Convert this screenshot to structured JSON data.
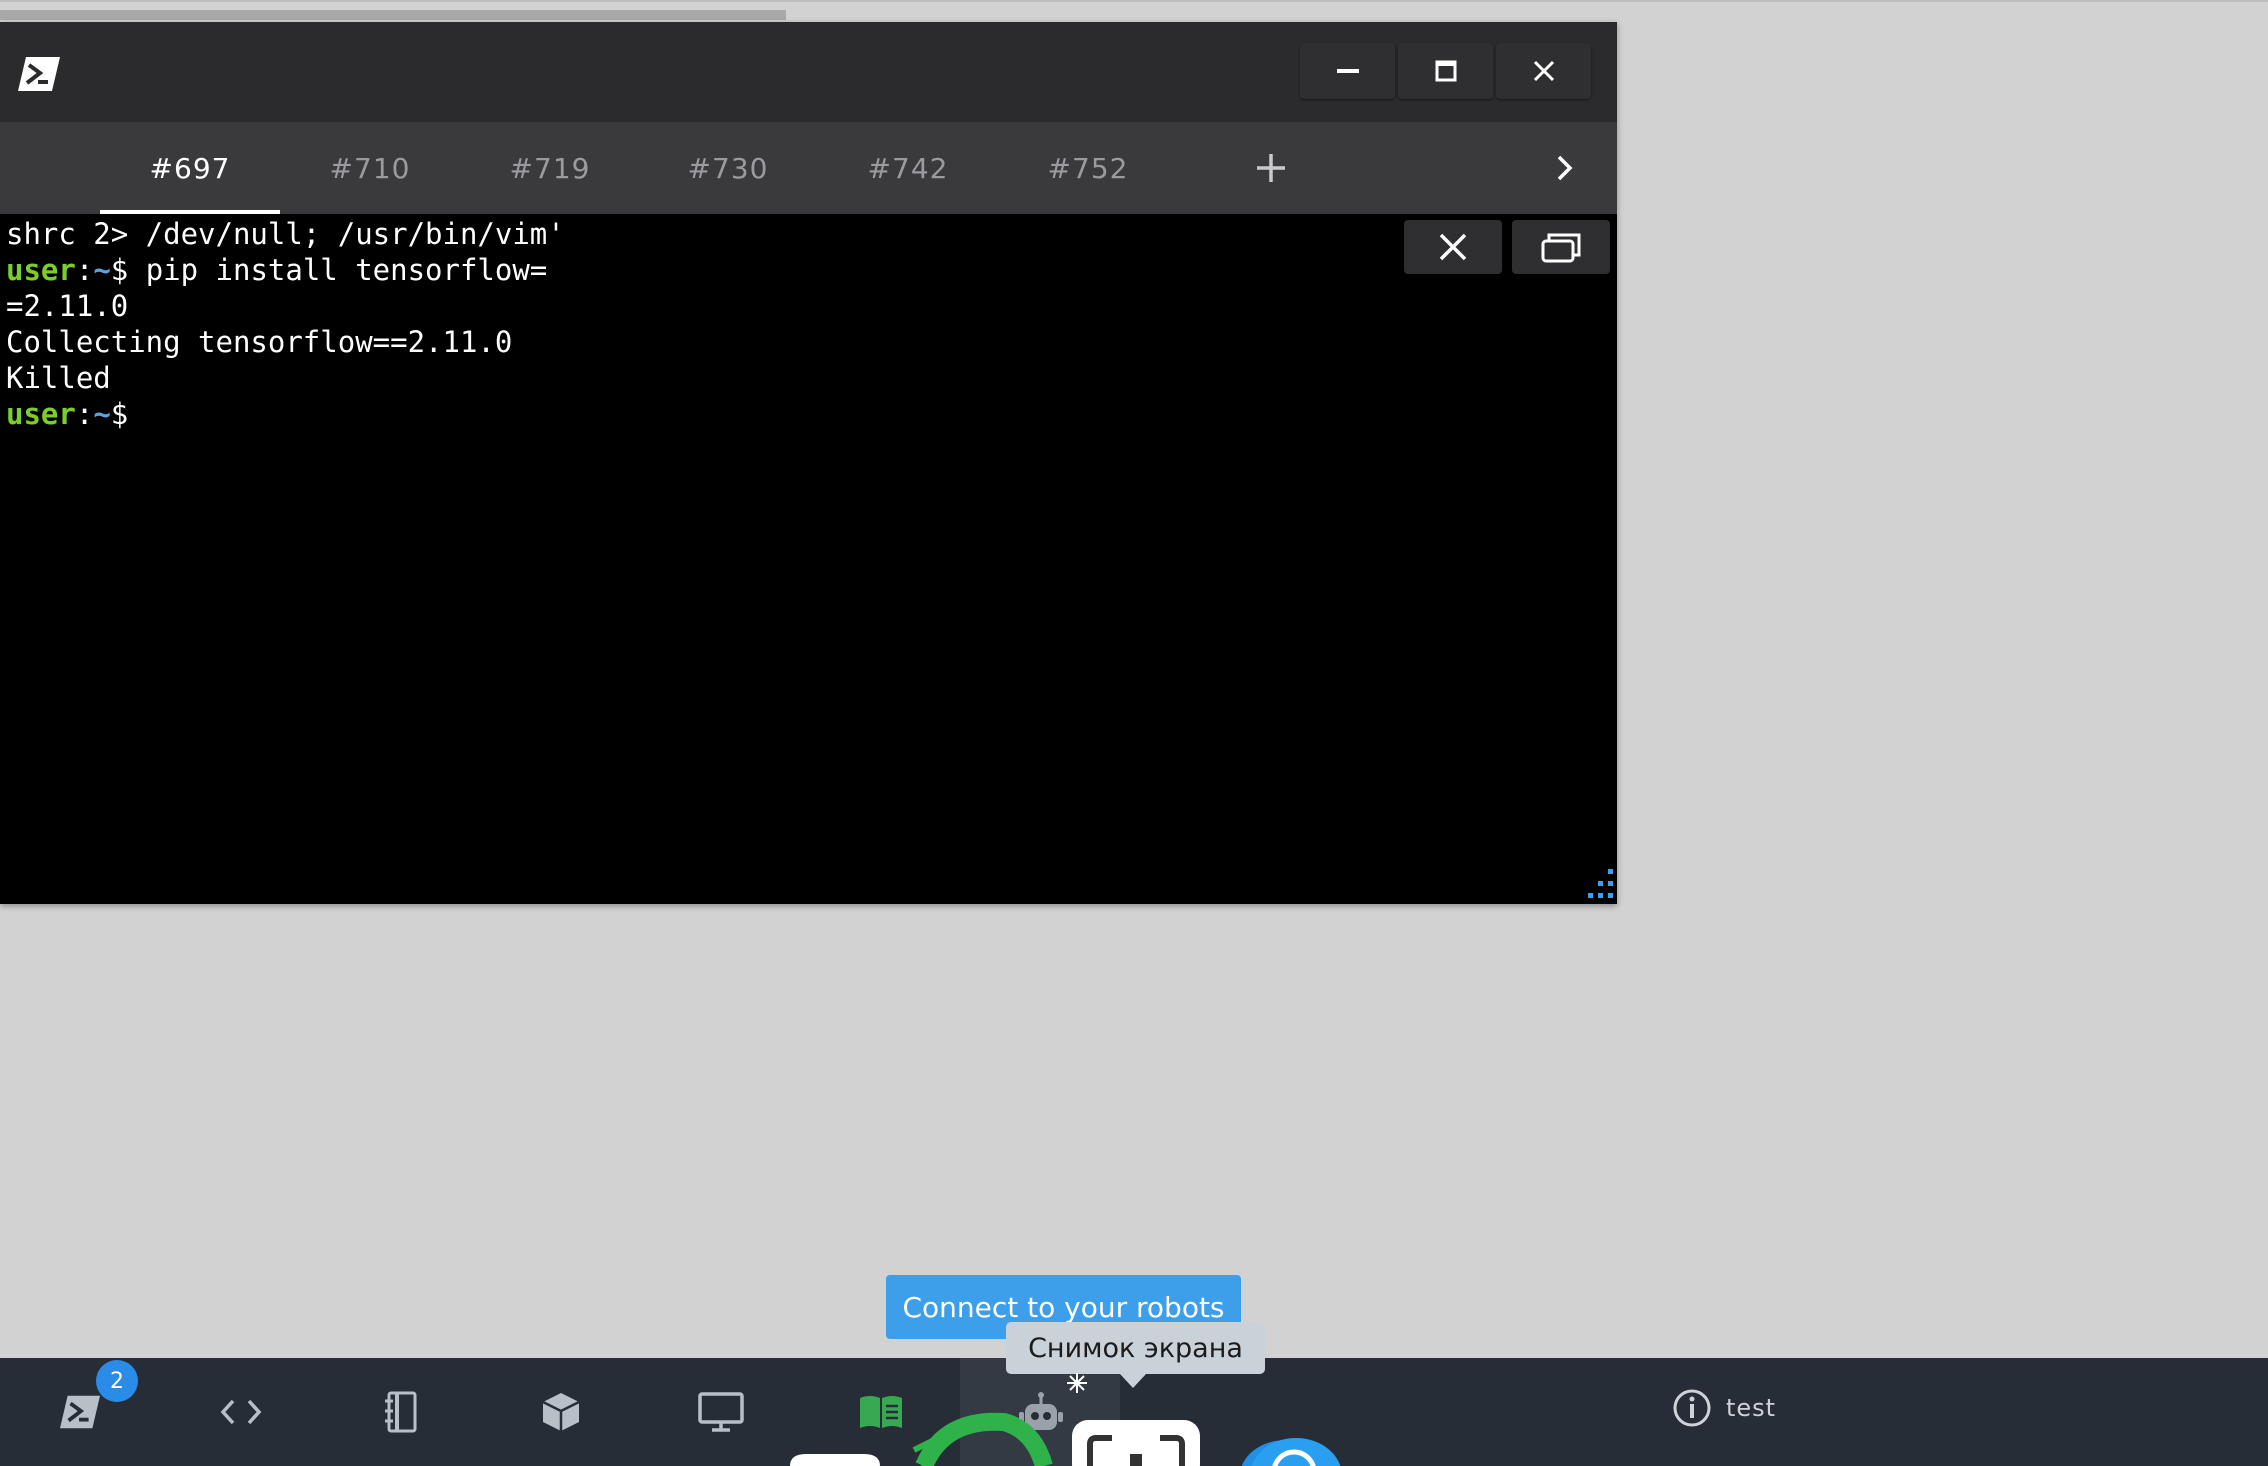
{
  "terminal": {
    "tabs": [
      "#697",
      "#710",
      "#719",
      "#730",
      "#742",
      "#752"
    ],
    "active_tab": "#697",
    "lines": {
      "l1": "shrc 2> /dev/null; /usr/bin/vim'",
      "l2_user": "user",
      "l2_colon": ":",
      "l2_tilde": "~",
      "l2_cmd": "$ pip install tensorflow=",
      "l3": "=2.11.0",
      "l4": "Collecting tensorflow==2.11.0",
      "l5": "Killed",
      "l6_user": "user",
      "l6_colon": ":",
      "l6_tilde": "~",
      "l6_cmd": "$"
    }
  },
  "taskbar": {
    "terminal_badge": "2",
    "info_label": "test"
  },
  "tooltips": {
    "connect": "Connect to your robots",
    "screenshot": "Снимок экрана"
  },
  "colors": {
    "user_prompt": "#7ccf2b",
    "path_prompt": "#5aa1e6",
    "accent": "#3d9eea",
    "taskbar": "#262d37"
  }
}
